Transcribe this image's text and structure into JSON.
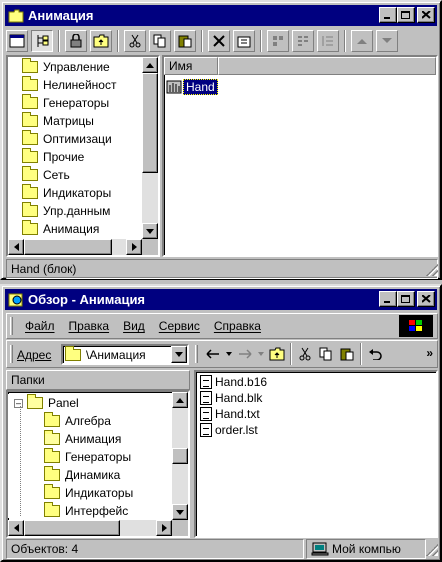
{
  "window1": {
    "title": "Анимация",
    "tree_items": [
      "Управление",
      "Нелинейност",
      "Генераторы",
      "Матрицы",
      "Оптимизаци",
      "Прочие",
      "Сеть",
      "Индикаторы",
      "Упр.данным",
      "Анимация"
    ],
    "column_header": "Имя",
    "list_items": [
      {
        "label": "Hand",
        "selected": true
      }
    ],
    "status": "Hand (блок)"
  },
  "window2": {
    "title": "Обзор - Анимация",
    "menu": [
      "Файл",
      "Правка",
      "Вид",
      "Сервис",
      "Справка"
    ],
    "address_label": "Адрес",
    "address_value": "\\Анимация",
    "folders_header": "Папки",
    "folder_root": "Panel",
    "folder_items": [
      "Алгебра",
      "Анимация",
      "Генераторы",
      "Динамика",
      "Индикаторы",
      "Интерфейс"
    ],
    "files": [
      "Hand.b16",
      "Hand.blk",
      "Hand.txt",
      "order.lst"
    ],
    "status_left": "Объектов: 4",
    "status_right": "Мой компью"
  },
  "colors": {
    "titlebar": "#000080",
    "face": "#c0c0c0",
    "selection": "#000080"
  }
}
